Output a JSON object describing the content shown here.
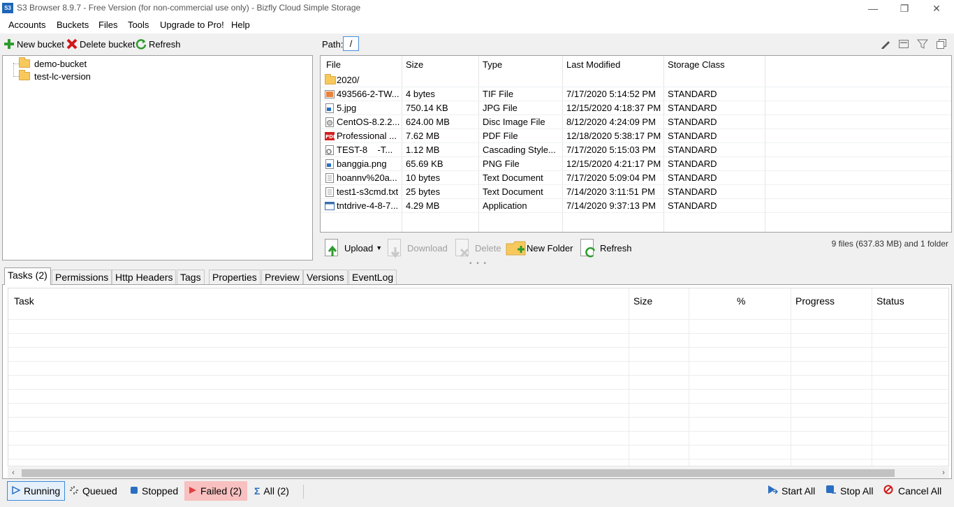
{
  "window": {
    "title": "S3 Browser 8.9.7 - Free Version (for non-commercial use only) - Bizfly Cloud Simple Storage",
    "app_icon_text": "S3",
    "min_glyph": "—",
    "max_glyph": "❐",
    "close_glyph": "✕"
  },
  "menu": [
    "Accounts",
    "Buckets",
    "Files",
    "Tools",
    "Upgrade to Pro!",
    "Help"
  ],
  "bucket_toolbar": {
    "new_bucket": "New bucket",
    "delete_bucket": "Delete bucket",
    "refresh": "Refresh"
  },
  "buckets": [
    "demo-bucket",
    "test-lc-version"
  ],
  "path": {
    "label": "Path:",
    "value": "/"
  },
  "file_columns": [
    "File",
    "Size",
    "Type",
    "Last Modified",
    "Storage Class"
  ],
  "files": [
    {
      "name": "2020/",
      "size": "",
      "type": "",
      "modified": "",
      "storage": "",
      "icon": "folder-icon"
    },
    {
      "name": "493566-2-TW...",
      "size": "4 bytes",
      "type": "TIF File",
      "modified": "7/17/2020 5:14:52 PM",
      "storage": "STANDARD",
      "icon": "image-file-icon"
    },
    {
      "name": "5.jpg",
      "size": "750.14 KB",
      "type": "JPG File",
      "modified": "12/15/2020 4:18:37 PM",
      "storage": "STANDARD",
      "icon": "jpg-file-icon"
    },
    {
      "name": "CentOS-8.2.2...",
      "size": "624.00 MB",
      "type": "Disc Image File",
      "modified": "8/12/2020 4:24:09 PM",
      "storage": "STANDARD",
      "icon": "disc-image-icon"
    },
    {
      "name": "Professional ...",
      "size": "7.62 MB",
      "type": "PDF File",
      "modified": "12/18/2020 5:38:17 PM",
      "storage": "STANDARD",
      "icon": "pdf-file-icon"
    },
    {
      "name": "TEST-8    -T...",
      "size": "1.12 MB",
      "type": "Cascading Style...",
      "modified": "7/17/2020 5:15:03 PM",
      "storage": "STANDARD",
      "icon": "css-file-icon"
    },
    {
      "name": "banggia.png",
      "size": "65.69 KB",
      "type": "PNG File",
      "modified": "12/15/2020 4:21:17 PM",
      "storage": "STANDARD",
      "icon": "png-file-icon"
    },
    {
      "name": "hoannv%20a...",
      "size": "10 bytes",
      "type": "Text Document",
      "modified": "7/17/2020 5:09:04 PM",
      "storage": "STANDARD",
      "icon": "text-file-icon"
    },
    {
      "name": "test1-s3cmd.txt",
      "size": "25 bytes",
      "type": "Text Document",
      "modified": "7/14/2020 3:11:51 PM",
      "storage": "STANDARD",
      "icon": "text-file-icon"
    },
    {
      "name": "tntdrive-4-8-7...",
      "size": "4.29 MB",
      "type": "Application",
      "modified": "7/14/2020 9:37:13 PM",
      "storage": "STANDARD",
      "icon": "application-icon"
    }
  ],
  "file_toolbar": {
    "upload": "Upload",
    "download": "Download",
    "delete": "Delete",
    "new_folder": "New Folder",
    "refresh": "Refresh",
    "summary": "9 files (637.83 MB) and 1 folder"
  },
  "tabs": [
    "Tasks (2)",
    "Permissions",
    "Http Headers",
    "Tags",
    "Properties",
    "Preview",
    "Versions",
    "EventLog"
  ],
  "task_columns": [
    "Task",
    "Size",
    "%",
    "Progress",
    "Status"
  ],
  "status": {
    "running": "Running",
    "queued": "Queued",
    "stopped": "Stopped",
    "failed": "Failed (2)",
    "all": "All (2)",
    "start_all": "Start All",
    "stop_all": "Stop All",
    "cancel_all": "Cancel All"
  },
  "colors": {
    "accent": "#3a8ad8",
    "failed_bg": "#f8c0c0",
    "folder": "#f7c95c"
  }
}
